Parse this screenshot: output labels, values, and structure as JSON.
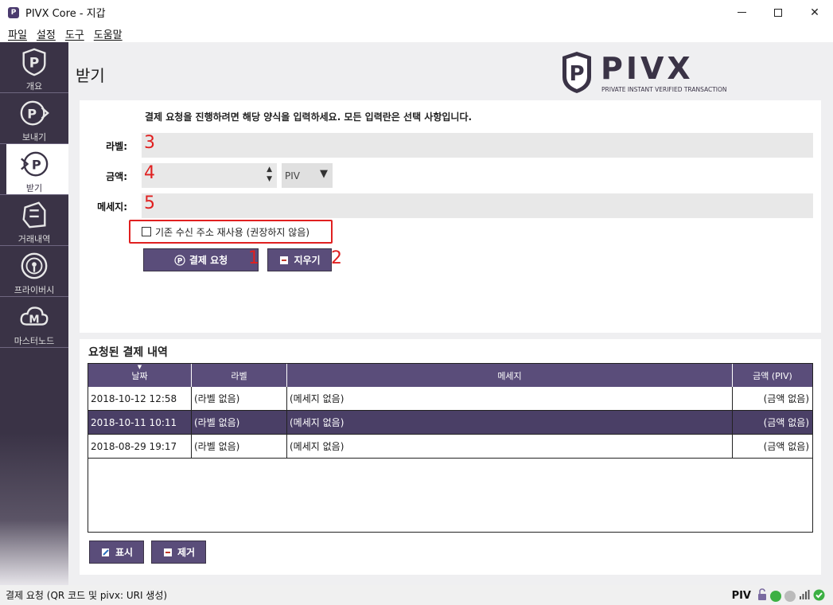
{
  "window": {
    "title": "PIVX Core - 지갑",
    "minimize": "",
    "maximize": "",
    "close": "✕"
  },
  "menu": [
    "파일",
    "설정",
    "도구",
    "도움말"
  ],
  "sidebar": {
    "items": [
      {
        "label": "개요",
        "icon": "overview-icon",
        "active": false
      },
      {
        "label": "보내기",
        "icon": "send-icon",
        "active": false
      },
      {
        "label": "받기",
        "icon": "receive-icon",
        "active": true
      },
      {
        "label": "거래내역",
        "icon": "transactions-icon",
        "active": false
      },
      {
        "label": "프라이버시",
        "icon": "privacy-icon",
        "active": false
      },
      {
        "label": "마스터노드",
        "icon": "masternode-icon",
        "active": false
      }
    ]
  },
  "page": {
    "title": "받기",
    "logo_text": "PIVX",
    "logo_tagline": "PRIVATE INSTANT VERIFIED TRANSACTION"
  },
  "form": {
    "intro": "결제 요청을 진행하려면 해당 양식을 입력하세요. 모든 입력란은 선택 사항입니다.",
    "label_label": "라벨:",
    "amount_label": "금액:",
    "message_label": "메세지:",
    "label_annotation": "3",
    "amount_annotation": "4",
    "message_annotation": "5",
    "unit": "PIV",
    "reuse_address": "기존 수신 주소 재사용 (권장하지 않음)",
    "request_button": "결제 요청",
    "clear_button": "지우기",
    "request_annotation": "1",
    "clear_annotation": "2"
  },
  "history": {
    "title": "요청된 결제 내역",
    "columns": [
      "날짜",
      "라벨",
      "메세지",
      "금액 (PIV)"
    ],
    "rows": [
      {
        "date": "2018-10-12 12:58",
        "label": "(라벨 없음)",
        "message": "(메세지 없음)",
        "amount": "(금액 없음)",
        "selected": false
      },
      {
        "date": "2018-10-11 10:11",
        "label": "(라벨 없음)",
        "message": "(메세지 없음)",
        "amount": "(금액 없음)",
        "selected": true
      },
      {
        "date": "2018-08-29 19:17",
        "label": "(라벨 없음)",
        "message": "(메세지 없음)",
        "amount": "(금액 없음)",
        "selected": false
      }
    ],
    "show_button": "표시",
    "remove_button": "제거"
  },
  "status": {
    "text": "결제 요청 (QR 코드 및 pivx: URI 생성)",
    "unit": "PIV"
  },
  "colors": {
    "accent": "#5a4d7a",
    "sidebar": "#3a3346",
    "annotation": "#e02020",
    "ok": "#3cb043"
  }
}
